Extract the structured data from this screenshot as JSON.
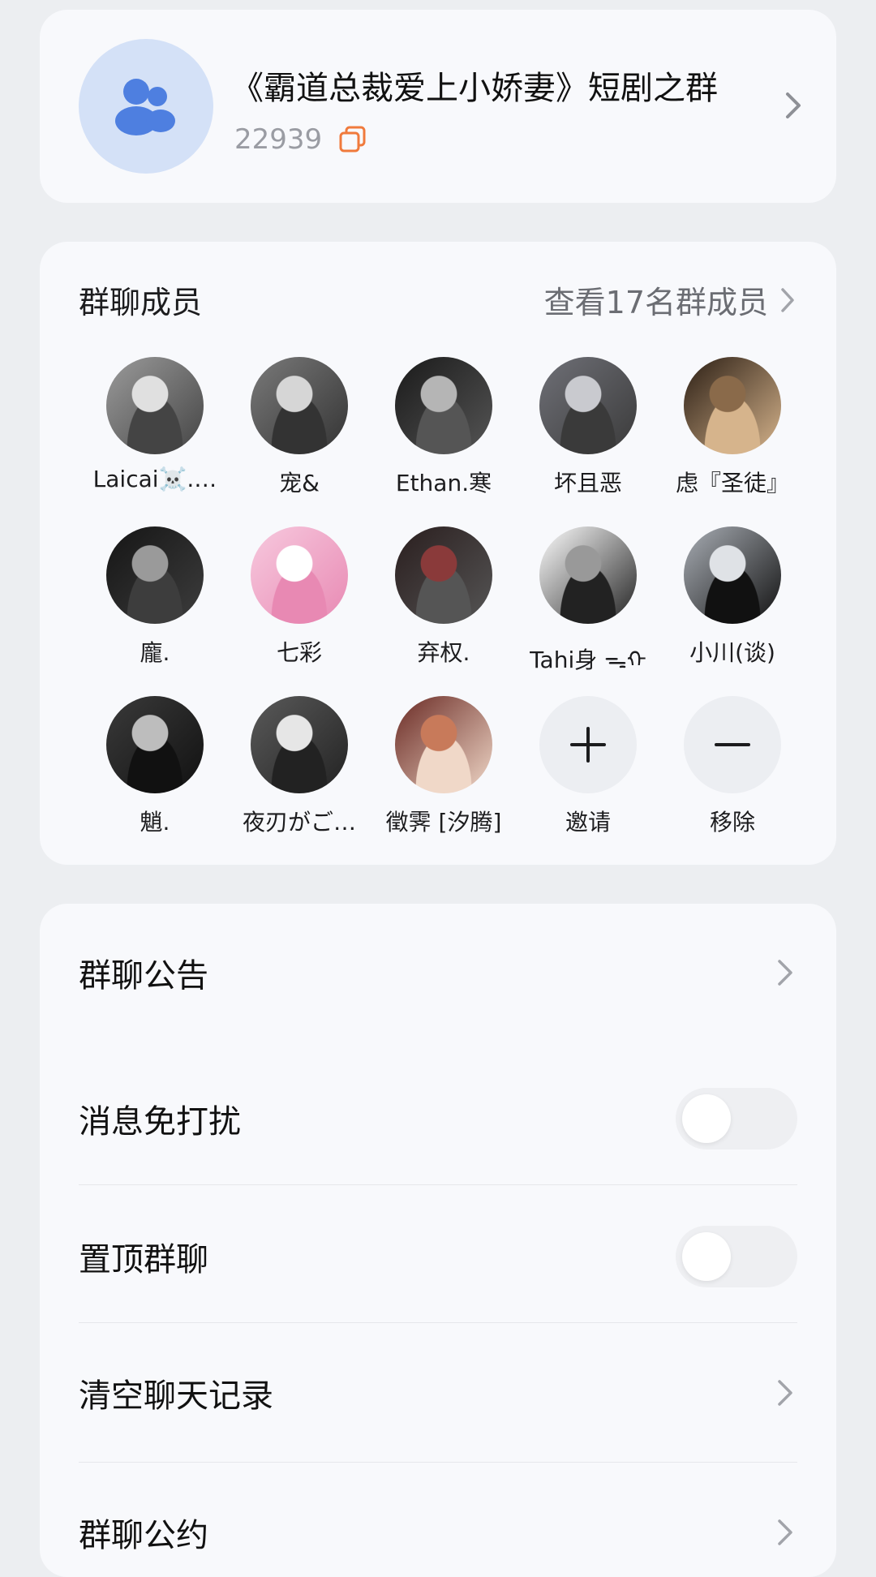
{
  "group": {
    "name": "《霸道总裁爱上小娇妻》短剧之群",
    "id": "22939"
  },
  "members_section": {
    "title": "群聊成员",
    "view_all": "查看17名群成员",
    "members": [
      {
        "name": "Laicai☠️.…",
        "colors": [
          "#9b9b9b",
          "#e0e0e0",
          "#444"
        ]
      },
      {
        "name": "宠&",
        "colors": [
          "#7a7a7a",
          "#d6d6d6",
          "#333"
        ]
      },
      {
        "name": "Ethan.寒",
        "colors": [
          "#1a1a1a",
          "#b5b5b5",
          "#555"
        ]
      },
      {
        "name": "坏且恶",
        "colors": [
          "#6f7077",
          "#c9cacf",
          "#3a3a3a"
        ]
      },
      {
        "name": "虑『圣徒』",
        "colors": [
          "#2b1e14",
          "#8a6a4a",
          "#d6b48c"
        ]
      },
      {
        "name": "龐.",
        "colors": [
          "#151515",
          "#9a9a9a",
          "#3d3d3d"
        ]
      },
      {
        "name": "七彩",
        "colors": [
          "#f7c9de",
          "#ffffff",
          "#e889b3"
        ]
      },
      {
        "name": "弃权.",
        "colors": [
          "#2a1e1e",
          "#8a3a3a",
          "#555"
        ]
      },
      {
        "name": "Tahi身 ᯓᡣ",
        "colors": [
          "#ffffff",
          "#999999",
          "#222"
        ]
      },
      {
        "name": "小川(谈)",
        "colors": [
          "#a9aeb5",
          "#dfe2e6",
          "#111"
        ]
      },
      {
        "name": "魈.",
        "colors": [
          "#3a3a3a",
          "#bdbdbd",
          "#111"
        ]
      },
      {
        "name": "夜刃がご…",
        "colors": [
          "#5a5a5a",
          "#e6e6e6",
          "#222"
        ]
      },
      {
        "name": "徵霁 [汐腾]",
        "colors": [
          "#6a2a24",
          "#c87a5a",
          "#f0d8c8"
        ]
      }
    ],
    "invite_label": "邀请",
    "remove_label": "移除"
  },
  "settings": {
    "announcement": "群聊公告",
    "mute": "消息免打扰",
    "mute_on": false,
    "pin": "置顶群聊",
    "pin_on": false,
    "clear_history": "清空聊天记录",
    "rules": "群聊公约"
  },
  "colors": {
    "page_bg": "#eceef1",
    "card_bg": "#f8f9fc",
    "accent_blue": "#4e7fe0",
    "copy_orange": "#f07a3c",
    "muted_text": "#9a9ca3"
  }
}
